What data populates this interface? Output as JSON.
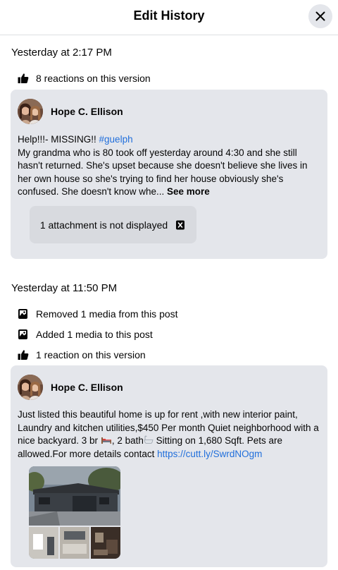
{
  "header": {
    "title": "Edit History"
  },
  "versions": [
    {
      "time": "Yesterday at 2:17 PM",
      "activity": [
        {
          "icon": "thumbs-up-icon",
          "text": "8 reactions on this version"
        }
      ],
      "author": "Hope C. Ellison",
      "text_before": "Help!!!- MISSING!! ",
      "hashtag": "#guelph",
      "body": "My grandma who is 80 took off yesterday around 4:30 and she still hasn't returned. She's upset because she doesn't believe she lives in her own house so she's trying to find her house obviously she's confused. She doesn't know whe...",
      "see_more": "See more",
      "attachment_note": "1 attachment is not displayed"
    },
    {
      "time": "Yesterday at 11:50 PM",
      "activity": [
        {
          "icon": "media-icon",
          "text": "Removed 1 media from this post"
        },
        {
          "icon": "media-icon",
          "text": "Added 1 media to this post"
        },
        {
          "icon": "thumbs-up-icon",
          "text": "1 reaction on this version"
        }
      ],
      "author": "Hope C. Ellison",
      "body_part1": "Just listed this beautiful home is up for rent ,with new interior paint, Laundry and kitchen utilities,$450 Per month Quiet neighborhood with a nice backyard. 3 br ",
      "body_part2": ", 2 bath",
      "body_part3": " Sitting on 1,680 Sqft. Pets are allowed.For more details contact ",
      "link": "https://cutt.ly/SwrdNOgm",
      "bed_emoji": "bed-icon",
      "bath_emoji": "bathtub-icon"
    }
  ],
  "colors": {
    "link": "#216fdb",
    "card_bg": "#e4e6eb",
    "attach_bg": "#d8dadf"
  }
}
